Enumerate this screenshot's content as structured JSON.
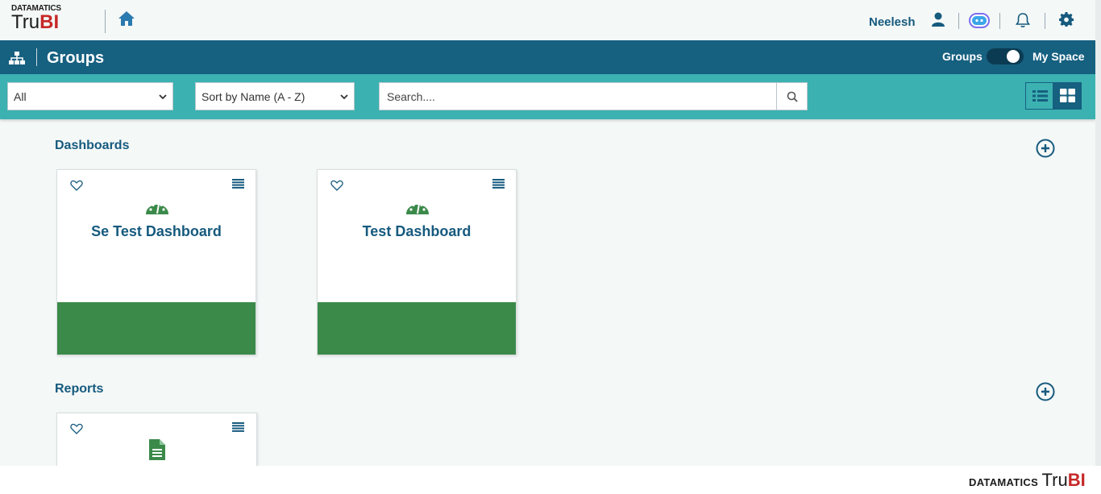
{
  "header": {
    "logo_small": "DATAMATICS",
    "logo_tru": "Tru",
    "logo_bi": "BI",
    "username": "Neelesh"
  },
  "groupbar": {
    "title": "Groups",
    "toggle_left": "Groups",
    "toggle_right": "My Space",
    "toggle_state": "My Space"
  },
  "filters": {
    "type_select": "All",
    "sort_select": "Sort by Name (A - Z)",
    "search_placeholder": "Search...."
  },
  "sections": {
    "dashboards_title": "Dashboards",
    "reports_title": "Reports"
  },
  "dashboards": [
    {
      "name": "Se Test Dashboard"
    },
    {
      "name": "Test Dashboard"
    }
  ],
  "footer": {
    "brand_small": "DATAMATICS",
    "brand_tru": "Tru",
    "brand_bi": "BI"
  },
  "colors": {
    "primary": "#166080",
    "teal": "#3bb1b1",
    "card_footer": "#3b8a4a",
    "accent_red": "#c62828"
  }
}
